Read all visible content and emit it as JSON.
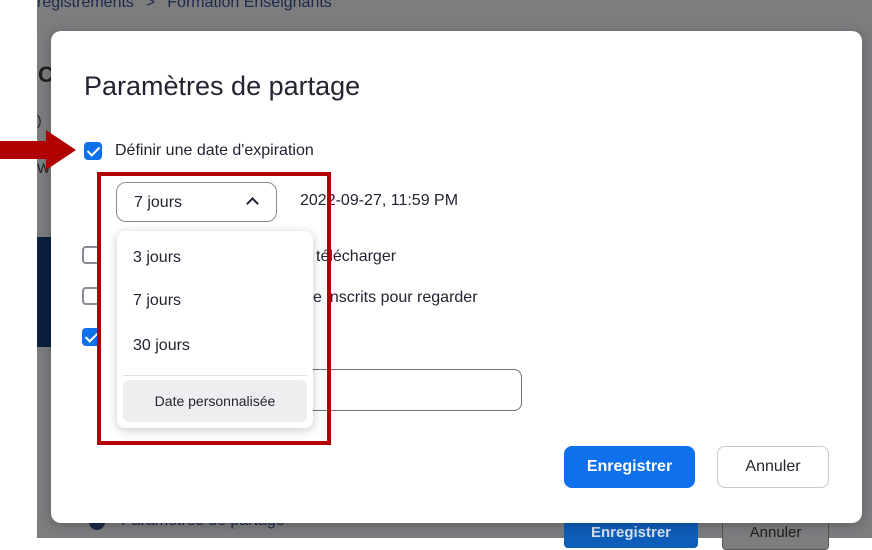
{
  "background": {
    "breadcrumb": {
      "parent": "registrements",
      "separator": ">",
      "current": "Formation Enseignants"
    },
    "fragments": [
      "C",
      ")",
      "W"
    ],
    "bottom_bar": {
      "label": "Paramètres de partage",
      "save_label": "Enregistrer",
      "cancel_label": "Annuler"
    }
  },
  "modal": {
    "title": "Paramètres de partage",
    "expiration": {
      "checked": true,
      "label": "Définir une date d'expiration",
      "selected": "7 jours",
      "datetime": "2022-09-27, 11:59 PM"
    },
    "options": [
      {
        "label": "télécharger",
        "checked": false
      },
      {
        "label": "e inscrits pour regarder",
        "checked": false
      },
      {
        "label": "",
        "checked": true
      }
    ],
    "save_label": "Enregistrer",
    "cancel_label": "Annuler"
  },
  "dropdown": {
    "options": [
      "3 jours",
      "7 jours",
      "30 jours"
    ],
    "custom_label": "Date personnalisée"
  },
  "colors": {
    "accent": "#0e71eb",
    "annotation": "#b00000",
    "overlay": "#7d7d80"
  }
}
